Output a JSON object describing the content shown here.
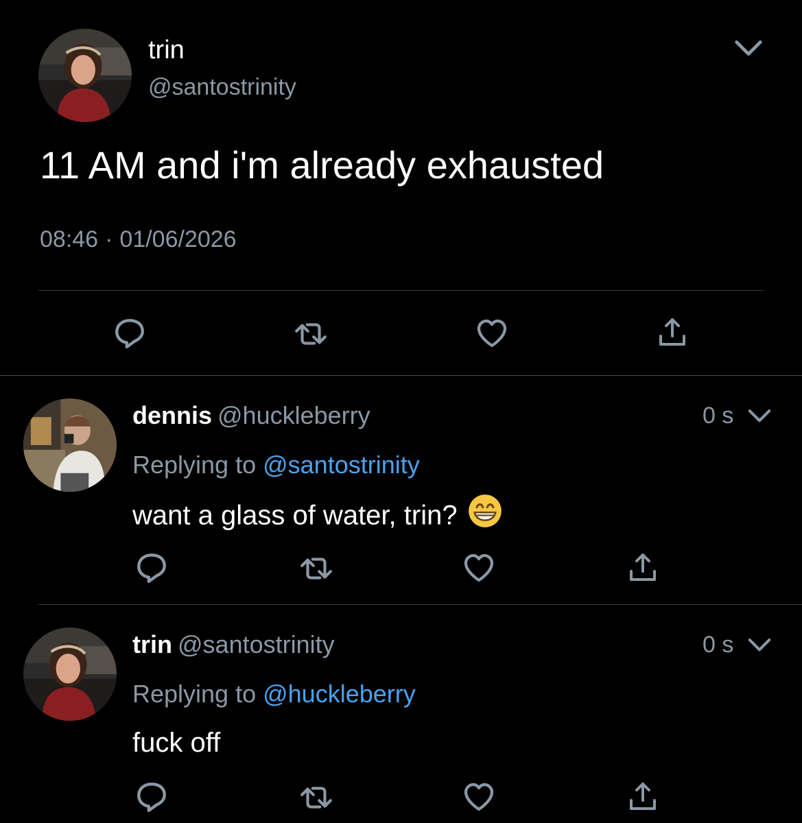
{
  "main_tweet": {
    "author_name": "trin",
    "author_handle": "@santostrinity",
    "avatar_icon": "profile-photo-woman-red-top",
    "text": "11 AM and i'm already exhausted",
    "time": "08:46",
    "separator": "·",
    "date": "01/06/2026",
    "actions": [
      "reply-icon",
      "retweet-icon",
      "like-icon",
      "share-icon"
    ]
  },
  "replies": [
    {
      "author_name": "dennis",
      "author_handle": "@huckleberry",
      "avatar_icon": "profile-photo-man-photographer",
      "time_ago": "0 s",
      "replying_label": "Replying to",
      "replying_to": "@santostrinity",
      "text": "want a glass of water, trin?",
      "emoji": "grinning-face-with-smiling-eyes"
    },
    {
      "author_name": "trin",
      "author_handle": "@santostrinity",
      "avatar_icon": "profile-photo-woman-red-top",
      "time_ago": "0 s",
      "replying_label": "Replying to",
      "replying_to": "@huckleberry",
      "text": "fuck off"
    }
  ],
  "colors": {
    "background": "#000000",
    "primary_text": "#ffffff",
    "secondary_text": "#8b98a5",
    "link": "#4aa3ef",
    "divider": "#3a3d41"
  }
}
